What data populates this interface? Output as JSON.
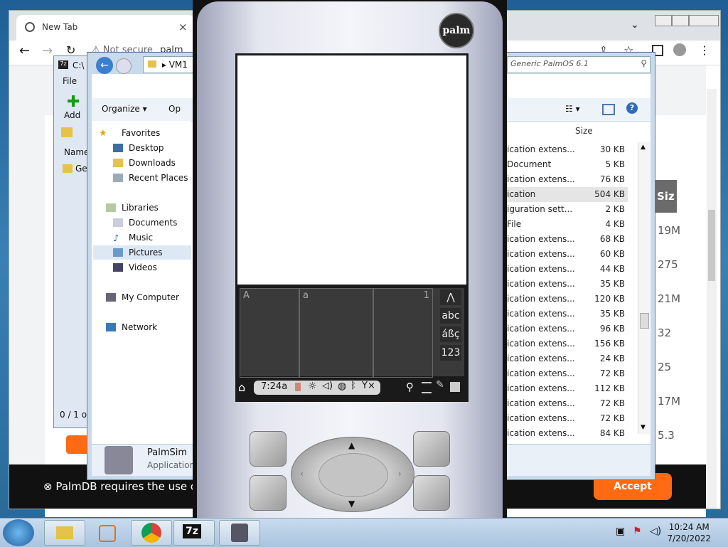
{
  "browser": {
    "tab_title": "New Tab",
    "tab_close": "×",
    "address_text": "Not secure",
    "address_partial": "palm",
    "cookie_text": "PalmDB requires the use o",
    "accept_label": "Accept",
    "right_column_header": "Siz",
    "right_column_cells": [
      "19M",
      "275",
      "21M",
      "32",
      "25",
      "17M",
      "5.3"
    ]
  },
  "sevenzip": {
    "title": "C:\\",
    "menu_file": "File",
    "add_label": "Add",
    "col_name": "Name",
    "row_partial": "Ge",
    "status": "0 / 1 ob"
  },
  "explorer": {
    "breadcrumb": "VM1",
    "search_placeholder": "Generic PalmOS 6.1",
    "organize_label": "Organize",
    "open_partial": "Op",
    "column_size": "Size",
    "nav": {
      "favorites": "Favorites",
      "desktop": "Desktop",
      "downloads": "Downloads",
      "recent_places": "Recent Places",
      "libraries": "Libraries",
      "documents": "Documents",
      "music": "Music",
      "pictures": "Pictures",
      "videos": "Videos",
      "my_computer": "My Computer",
      "network": "Network"
    },
    "files": [
      {
        "type": "ication extens...",
        "size": "30 KB"
      },
      {
        "type": "Document",
        "size": "5 KB"
      },
      {
        "type": "ication extens...",
        "size": "76 KB"
      },
      {
        "type": "ication",
        "size": "504 KB"
      },
      {
        "type": "iguration sett...",
        "size": "2 KB"
      },
      {
        "type": "File",
        "size": "4 KB"
      },
      {
        "type": "ication extens...",
        "size": "68 KB"
      },
      {
        "type": "ication extens...",
        "size": "60 KB"
      },
      {
        "type": "ication extens...",
        "size": "44 KB"
      },
      {
        "type": "ication extens...",
        "size": "35 KB"
      },
      {
        "type": "ication extens...",
        "size": "120 KB"
      },
      {
        "type": "ication extens...",
        "size": "35 KB"
      },
      {
        "type": "ication extens...",
        "size": "96 KB"
      },
      {
        "type": "ication extens...",
        "size": "156 KB"
      },
      {
        "type": "ication extens...",
        "size": "24 KB"
      },
      {
        "type": "ication extens...",
        "size": "72 KB"
      },
      {
        "type": "ication extens...",
        "size": "112 KB"
      },
      {
        "type": "ication extens...",
        "size": "72 KB"
      },
      {
        "type": "ication extens...",
        "size": "72 KB"
      },
      {
        "type": "ication extens...",
        "size": "84 KB"
      }
    ],
    "details": {
      "name": "PalmSim",
      "type": "Application"
    }
  },
  "palm": {
    "logo": "palm",
    "graffiti_left": "A",
    "graffiti_mid": "a",
    "graffiti_right": "1",
    "btn_up": "⋀",
    "btn_abc": "abc",
    "btn_accent": "áßç",
    "btn_num": "123",
    "time": "7:24a"
  },
  "taskbar": {
    "time": "10:24 AM",
    "date": "7/20/2022",
    "sevenzip_label": "7z"
  }
}
